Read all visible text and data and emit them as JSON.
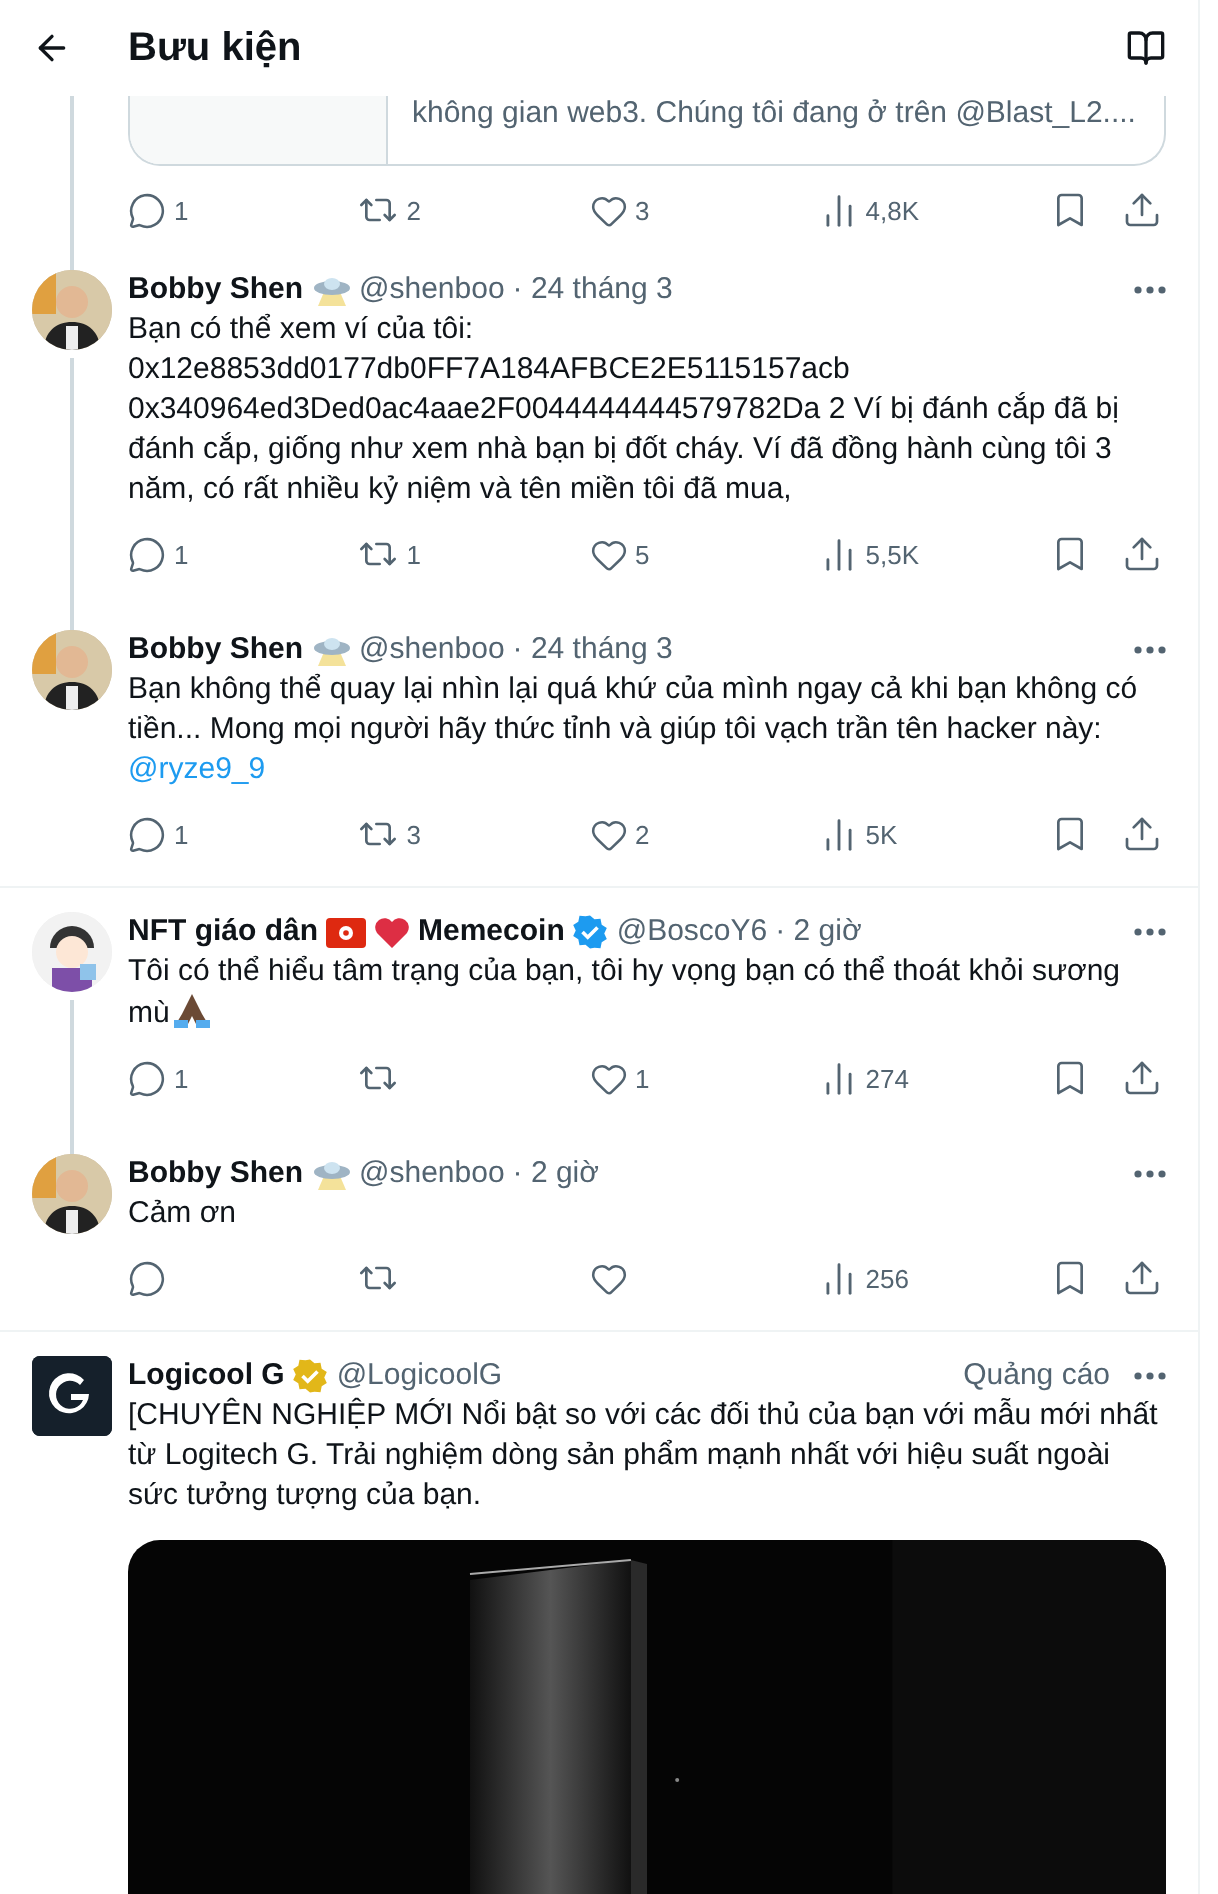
{
  "header": {
    "title": "Bưu kiện"
  },
  "quoted_card": {
    "text": "không gian web3. Chúng tôi đang ở trên @Blast_L2...."
  },
  "top_stats": {
    "replies": "1",
    "reposts": "2",
    "likes": "3",
    "views": "4,8K"
  },
  "posts": [
    {
      "kind": "tweet",
      "name": [
        {
          "kind": "text",
          "text": "Bobby Shen"
        },
        {
          "kind": "ufo"
        }
      ],
      "handle": "@shenboo",
      "time": "· 24 tháng 3",
      "thread_above": true,
      "thread_below": true,
      "divider": false,
      "body": "Bạn có thể xem ví của tôi:\n0x12e8853dd0177db0FF7A184AFBCE2E5115157acb\n0x340964ed3Ded0ac4aae2F0044444444579782Da 2 Ví bị đánh cắp đã bị đánh cắp, giống như xem nhà bạn bị đốt cháy. Ví đã đồng hành cùng tôi 3 năm, có rất nhiều kỷ niệm và tên miền tôi đã mua,",
      "stats": {
        "replies": "1",
        "reposts": "1",
        "likes": "5",
        "views": "5,5K"
      }
    },
    {
      "kind": "tweet",
      "name": [
        {
          "kind": "text",
          "text": "Bobby Shen"
        },
        {
          "kind": "ufo"
        }
      ],
      "handle": "@shenboo",
      "time": "· 24 tháng 3",
      "thread_above": true,
      "thread_below": false,
      "divider": true,
      "body": "Bạn không thể quay lại nhìn lại quá khứ của mình ngay cả khi bạn không có tiền... Mong mọi người hãy thức tỉnh và giúp tôi vạch trần tên hacker này:",
      "mention": "@ryze9_9",
      "stats": {
        "replies": "1",
        "reposts": "3",
        "likes": "2",
        "views": "5K"
      }
    },
    {
      "kind": "tweet",
      "avatar": {
        "kind": "cartoon"
      },
      "name": [
        {
          "kind": "text",
          "text": "NFT giáo dân"
        },
        {
          "kind": "flag"
        },
        {
          "kind": "heart"
        },
        {
          "kind": "text",
          "text": "Memecoin"
        }
      ],
      "badge": {
        "kind": "verified",
        "color": "#1d9bf0"
      },
      "handle": "@BoscoY6",
      "time": "· 2 giờ",
      "thread_above": false,
      "thread_below": true,
      "divider": false,
      "body": "Tôi có thể hiểu tâm trạng của bạn, tôi hy vọng bạn có thể thoát khỏi sương mù",
      "trailing_icon": {
        "kind": "pray"
      },
      "stats": {
        "replies": "1",
        "likes": "1",
        "views": "274"
      }
    },
    {
      "kind": "tweet",
      "name": [
        {
          "kind": "text",
          "text": "Bobby Shen"
        },
        {
          "kind": "ufo"
        }
      ],
      "handle": "@shenboo",
      "time": "· 2 giờ",
      "thread_above": true,
      "thread_below": false,
      "divider": true,
      "body": "Cảm ơn",
      "stats": {
        "views": "256"
      }
    },
    {
      "kind": "ad",
      "avatar": {
        "kind": "logo"
      },
      "name": [
        {
          "kind": "text",
          "text": "Logicool G"
        }
      ],
      "badge": {
        "kind": "verified",
        "color": "#e2b719"
      },
      "handle": "@LogicoolG",
      "ad_label": "Quảng cáo",
      "thread_above": false,
      "thread_below": false,
      "body": "[CHUYÊN NGHIỆP MỚI Nổi bật so với các đối thủ của bạn với mẫu mới nhất từ Logitech G. Trải nghiệm dòng sản phẩm mạnh nhất với hiệu suất ngoài sức tưởng tượng của bạn.",
      "media": {
        "kind": "picture"
      }
    }
  ]
}
